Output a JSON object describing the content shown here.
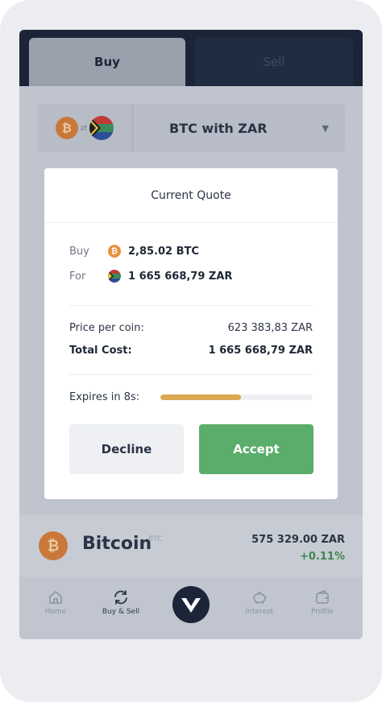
{
  "tabs": {
    "buy": "Buy",
    "sell": "Sell"
  },
  "pair": {
    "label": "BTC with ZAR"
  },
  "modal": {
    "title": "Current Quote",
    "buy_label": "Buy",
    "buy_value": "2,85.02 BTC",
    "for_label": "For",
    "for_value": "1 665 668,79 ZAR",
    "price_label": "Price per coin:",
    "price_value": "623 383,83 ZAR",
    "total_label": "Total Cost:",
    "total_value": "1 665 668,79 ZAR",
    "expires_label": "Expires in 8s:",
    "expires_progress": 0.53,
    "decline_label": "Decline",
    "accept_label": "Accept"
  },
  "asset": {
    "name": "Bitcoin",
    "symbol": "BTC",
    "price": "575 329.00 ZAR",
    "change": "+0.11%"
  },
  "nav": {
    "home": "Home",
    "buy_sell": "Buy & Sell",
    "interest": "Interest",
    "profile": "Profile"
  },
  "colors": {
    "accent_green": "#5aad6b",
    "bitcoin_orange": "#e8913c",
    "navy": "#1b2537",
    "progress": "#dba853"
  }
}
